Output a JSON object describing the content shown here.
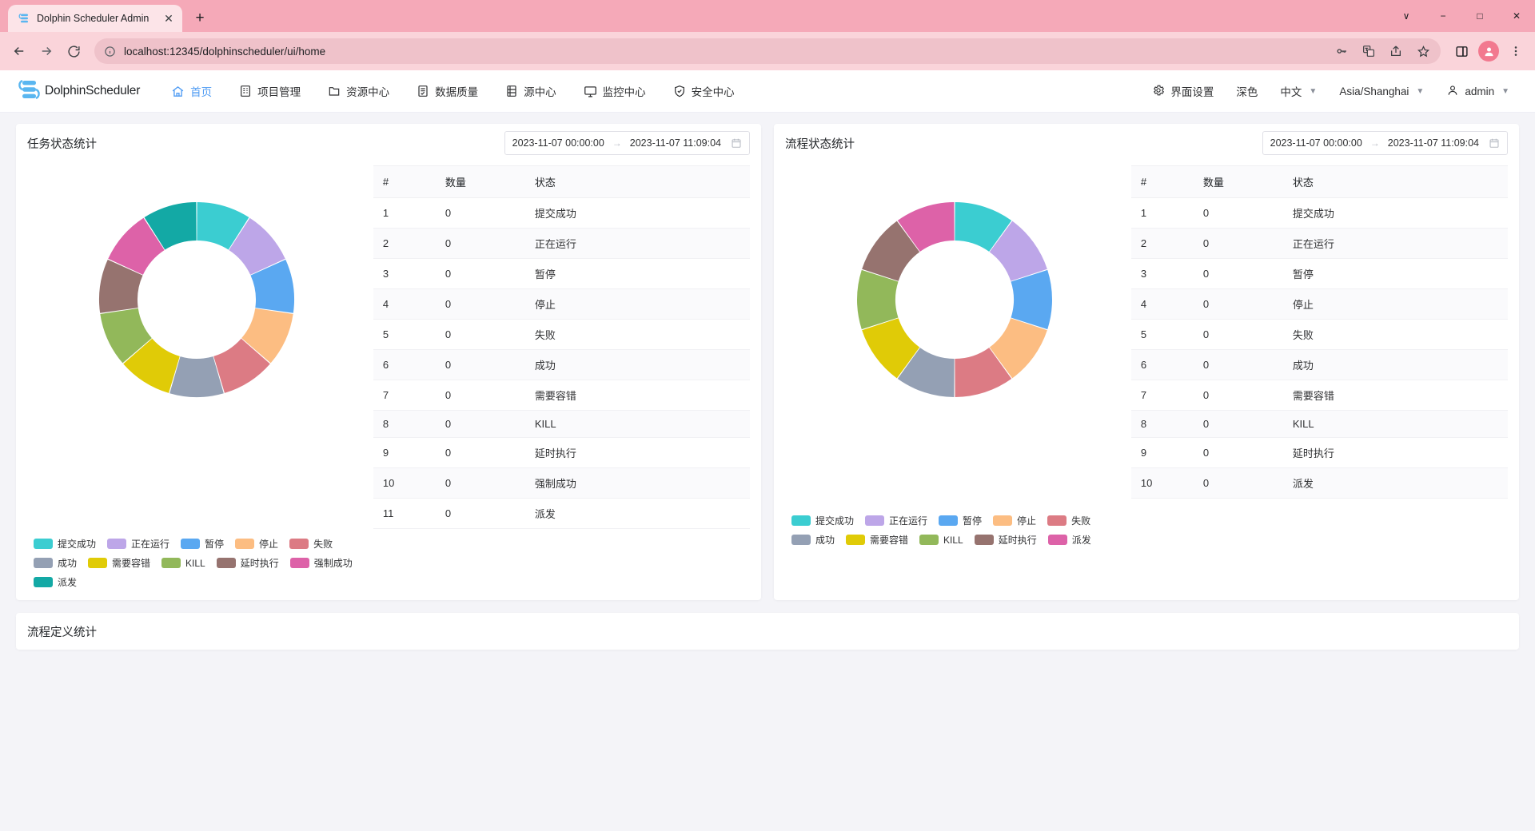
{
  "browser": {
    "tab": {
      "title": "Dolphin Scheduler Admin",
      "favicon_icon": "dolphin-favicon",
      "close_icon": "close-icon"
    },
    "new_tab_label": "+",
    "window_controls": [
      {
        "name": "chevron-down-icon",
        "label": "∨"
      },
      {
        "name": "minimize-icon",
        "label": "−"
      },
      {
        "name": "maximize-icon",
        "label": "□"
      },
      {
        "name": "close-window-icon",
        "label": "✕"
      }
    ],
    "nav_icons": [
      {
        "name": "back-icon",
        "label": "←"
      },
      {
        "name": "forward-icon",
        "label": "→"
      },
      {
        "name": "reload-icon",
        "label": "⟳"
      }
    ],
    "omnibox": {
      "info_icon": "site-info-icon",
      "url": "localhost:12345/dolphinscheduler/ui/home",
      "right_icons": [
        {
          "name": "password-key-icon",
          "label": "⚷"
        },
        {
          "name": "translate-icon",
          "label": "文"
        },
        {
          "name": "share-icon",
          "label": "➦"
        },
        {
          "name": "bookmark-star-icon",
          "label": "☆"
        }
      ]
    },
    "toolbar_right": [
      {
        "name": "side-panel-icon",
        "label": "◱"
      },
      {
        "name": "profile-avatar",
        "label": "●"
      },
      {
        "name": "browser-menu-icon",
        "label": "⋮"
      }
    ]
  },
  "appbar": {
    "brand": "DolphinScheduler",
    "logo_icon": "dolphinscheduler-logo",
    "nav": [
      {
        "label": "首页",
        "icon": "home-icon",
        "active": true
      },
      {
        "label": "项目管理",
        "icon": "project-icon",
        "active": false
      },
      {
        "label": "资源中心",
        "icon": "folder-icon",
        "active": false
      },
      {
        "label": "数据质量",
        "icon": "quality-icon",
        "active": false
      },
      {
        "label": "源中心",
        "icon": "datasource-icon",
        "active": false
      },
      {
        "label": "监控中心",
        "icon": "monitor-icon",
        "active": false
      },
      {
        "label": "安全中心",
        "icon": "shield-icon",
        "active": false
      }
    ],
    "right": [
      {
        "label": "界面设置",
        "icon": "gear-icon",
        "caret": false
      },
      {
        "label": "深色",
        "icon": "",
        "caret": false
      },
      {
        "label": "中文",
        "icon": "",
        "caret": true
      },
      {
        "label": "Asia/Shanghai",
        "icon": "",
        "caret": true
      },
      {
        "label": "admin",
        "icon": "user-icon",
        "caret": true
      }
    ]
  },
  "colors": {
    "submit_success": "#3bcdd1",
    "running": "#bda6e8",
    "pause": "#5aa8f1",
    "stop": "#fcbd82",
    "failure": "#dc7b84",
    "success": "#94a0b4",
    "need_fault_tolerance": "#e0cb07",
    "kill": "#92b85a",
    "delay_execution": "#96736f",
    "force_success": "#dd62a8",
    "dispatch_left": "#13a9a5",
    "dispatch_right": "#dd62a8",
    "browser_theme": "#f5a9b8",
    "accent": "#4e9bf3"
  },
  "task_card": {
    "title": "任务状态统计",
    "daterange": {
      "start": "2023-11-07 00:00:00",
      "arrow": "→",
      "end": "2023-11-07 11:09:04",
      "calendar_icon": "calendar-icon"
    },
    "table": {
      "headers": [
        "#",
        "数量",
        "状态"
      ],
      "rows": [
        {
          "idx": "1",
          "count": "0",
          "state": "提交成功"
        },
        {
          "idx": "2",
          "count": "0",
          "state": "正在运行"
        },
        {
          "idx": "3",
          "count": "0",
          "state": "暂停"
        },
        {
          "idx": "4",
          "count": "0",
          "state": "停止"
        },
        {
          "idx": "5",
          "count": "0",
          "state": "失败"
        },
        {
          "idx": "6",
          "count": "0",
          "state": "成功"
        },
        {
          "idx": "7",
          "count": "0",
          "state": "需要容错"
        },
        {
          "idx": "8",
          "count": "0",
          "state": "KILL"
        },
        {
          "idx": "9",
          "count": "0",
          "state": "延时执行"
        },
        {
          "idx": "10",
          "count": "0",
          "state": "强制成功"
        },
        {
          "idx": "11",
          "count": "0",
          "state": "派发"
        }
      ]
    },
    "legend": [
      {
        "label": "提交成功",
        "color": "#3bcdd1"
      },
      {
        "label": "正在运行",
        "color": "#bda6e8"
      },
      {
        "label": "暂停",
        "color": "#5aa8f1"
      },
      {
        "label": "停止",
        "color": "#fcbd82"
      },
      {
        "label": "失败",
        "color": "#dc7b84"
      },
      {
        "label": "成功",
        "color": "#94a0b4"
      },
      {
        "label": "需要容错",
        "color": "#e0cb07"
      },
      {
        "label": "KILL",
        "color": "#92b85a"
      },
      {
        "label": "延时执行",
        "color": "#96736f"
      },
      {
        "label": "强制成功",
        "color": "#dd62a8"
      },
      {
        "label": "派发",
        "color": "#13a9a5"
      }
    ]
  },
  "process_card": {
    "title": "流程状态统计",
    "daterange": {
      "start": "2023-11-07 00:00:00",
      "arrow": "→",
      "end": "2023-11-07 11:09:04",
      "calendar_icon": "calendar-icon"
    },
    "table": {
      "headers": [
        "#",
        "数量",
        "状态"
      ],
      "rows": [
        {
          "idx": "1",
          "count": "0",
          "state": "提交成功"
        },
        {
          "idx": "2",
          "count": "0",
          "state": "正在运行"
        },
        {
          "idx": "3",
          "count": "0",
          "state": "暂停"
        },
        {
          "idx": "4",
          "count": "0",
          "state": "停止"
        },
        {
          "idx": "5",
          "count": "0",
          "state": "失败"
        },
        {
          "idx": "6",
          "count": "0",
          "state": "成功"
        },
        {
          "idx": "7",
          "count": "0",
          "state": "需要容错"
        },
        {
          "idx": "8",
          "count": "0",
          "state": "KILL"
        },
        {
          "idx": "9",
          "count": "0",
          "state": "延时执行"
        },
        {
          "idx": "10",
          "count": "0",
          "state": "派发"
        }
      ]
    },
    "legend": [
      {
        "label": "提交成功",
        "color": "#3bcdd1"
      },
      {
        "label": "正在运行",
        "color": "#bda6e8"
      },
      {
        "label": "暂停",
        "color": "#5aa8f1"
      },
      {
        "label": "停止",
        "color": "#fcbd82"
      },
      {
        "label": "失败",
        "color": "#dc7b84"
      },
      {
        "label": "成功",
        "color": "#94a0b4"
      },
      {
        "label": "需要容错",
        "color": "#e0cb07"
      },
      {
        "label": "KILL",
        "color": "#92b85a"
      },
      {
        "label": "延时执行",
        "color": "#96736f"
      },
      {
        "label": "派发",
        "color": "#dd62a8"
      }
    ]
  },
  "bottom_card": {
    "title": "流程定义统计"
  },
  "chart_data": [
    {
      "type": "pie",
      "title": "任务状态统计",
      "donut": true,
      "legend_position": "bottom-left",
      "labels": [
        "提交成功",
        "正在运行",
        "暂停",
        "停止",
        "失败",
        "成功",
        "需要容错",
        "KILL",
        "延时执行",
        "强制成功",
        "派发"
      ],
      "values": [
        0,
        0,
        0,
        0,
        0,
        0,
        0,
        0,
        0,
        0,
        0
      ],
      "display_slices": [
        1,
        1,
        1,
        1,
        1,
        1,
        1,
        1,
        1,
        1,
        1
      ],
      "colors": [
        "#3bcdd1",
        "#bda6e8",
        "#5aa8f1",
        "#fcbd82",
        "#dc7b84",
        "#94a0b4",
        "#e0cb07",
        "#92b85a",
        "#96736f",
        "#dd62a8",
        "#13a9a5"
      ]
    },
    {
      "type": "pie",
      "title": "流程状态统计",
      "donut": true,
      "legend_position": "bottom-left",
      "labels": [
        "提交成功",
        "正在运行",
        "暂停",
        "停止",
        "失败",
        "成功",
        "需要容错",
        "KILL",
        "延时执行",
        "派发"
      ],
      "values": [
        0,
        0,
        0,
        0,
        0,
        0,
        0,
        0,
        0,
        0
      ],
      "display_slices": [
        1,
        1,
        1,
        1,
        1,
        1,
        1,
        1,
        1,
        1
      ],
      "colors": [
        "#3bcdd1",
        "#bda6e8",
        "#5aa8f1",
        "#fcbd82",
        "#dc7b84",
        "#94a0b4",
        "#e0cb07",
        "#92b85a",
        "#96736f",
        "#dd62a8"
      ]
    }
  ]
}
